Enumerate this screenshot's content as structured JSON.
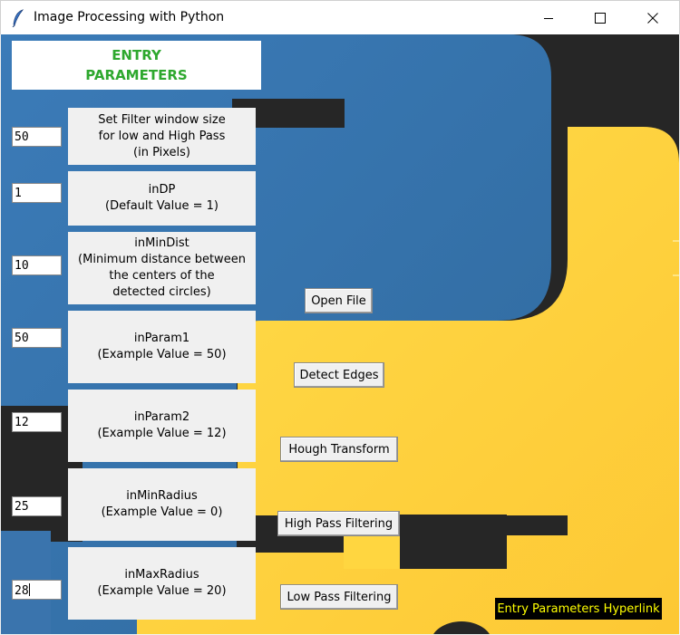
{
  "window": {
    "title": "Image Processing with Python",
    "minimize_icon": "minimize-icon",
    "maximize_icon": "maximize-icon",
    "close_icon": "close-icon",
    "app_icon": "feather-icon"
  },
  "header": {
    "line1": "ENTRY",
    "line2": "PARAMETERS",
    "color": "#2ea82e"
  },
  "params": [
    {
      "value": "50",
      "lines": [
        "Set Filter window size",
        "for low and High Pass",
        "(in Pixels)"
      ]
    },
    {
      "value": "1",
      "lines": [
        "inDP",
        "(Default Value = 1)"
      ]
    },
    {
      "value": "10",
      "lines": [
        "inMinDist",
        "(Minimum distance between",
        "the centers of the",
        "detected circles)"
      ]
    },
    {
      "value": "50",
      "lines": [
        "inParam1",
        "(Example Value = 50)"
      ]
    },
    {
      "value": "12",
      "lines": [
        "inParam2",
        "(Example Value = 12)"
      ]
    },
    {
      "value": "25",
      "lines": [
        "inMinRadius",
        "(Example Value = 0)"
      ]
    },
    {
      "value": "28",
      "lines": [
        "inMaxRadius",
        "(Example Value = 20)"
      ]
    }
  ],
  "buttons": {
    "open_file": "Open File",
    "detect_edges": "Detect Edges",
    "hough_transform": "Hough Transform",
    "high_pass": "High Pass Filtering",
    "low_pass": "Low Pass Filtering"
  },
  "hyperlink": {
    "label": "Entry Parameters Hyperlink",
    "text_color": "#ffff00"
  },
  "background": {
    "description_colors": {
      "blue": "#3572a5",
      "yellow": "#ffd43b",
      "dark": "#262626"
    }
  }
}
